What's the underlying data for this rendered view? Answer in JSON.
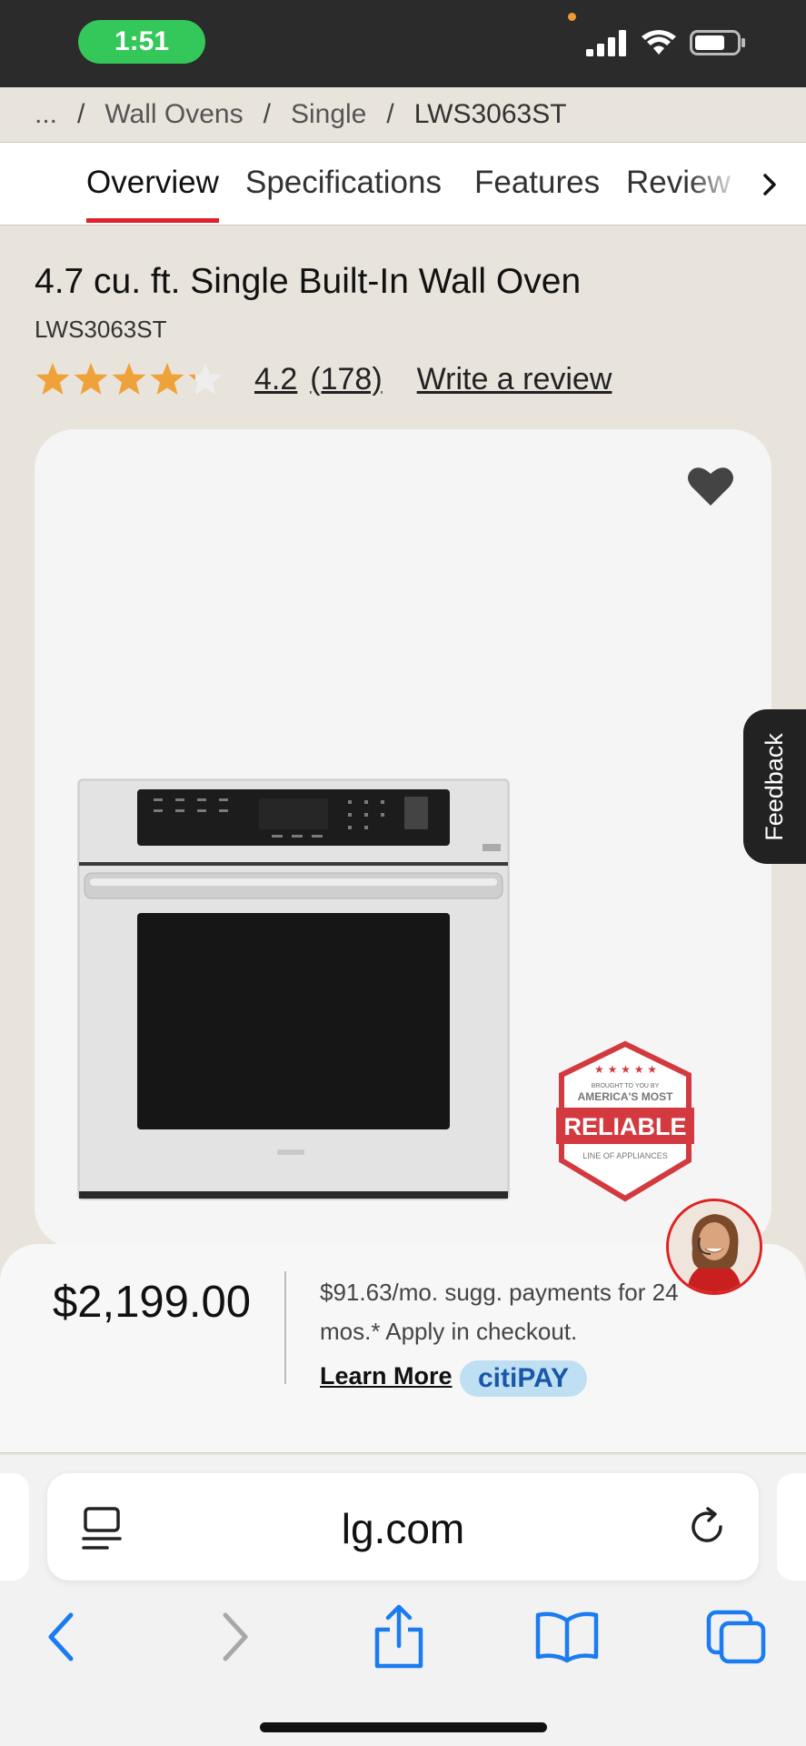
{
  "status_bar": {
    "time": "1:51"
  },
  "breadcrumb": {
    "ellipsis": "...",
    "separator": "/",
    "items": [
      "Wall Ovens",
      "Single"
    ],
    "current": "LWS3063ST"
  },
  "tabs": [
    {
      "label": "Overview",
      "active": true
    },
    {
      "label": "Specifications",
      "active": false
    },
    {
      "label": "Features",
      "active": false
    },
    {
      "label": "Review",
      "active": false
    }
  ],
  "product": {
    "title": "4.7 cu. ft. Single Built-In Wall Oven",
    "model": "LWS3063ST",
    "rating_value": "4.2",
    "rating_stars": 4.2,
    "review_count": "(178)",
    "write_review": "Write a review"
  },
  "feedback_label": "Feedback",
  "badge": {
    "line1": "BROUGHT TO YOU BY",
    "line2": "AMERICA'S MOST",
    "line3": "RELIABLE",
    "line4": "LINE OF APPLIANCES"
  },
  "price_sheet": {
    "price": "$2,199.00",
    "payment_text": "$91.63/mo. sugg. payments for 24 mos.* Apply in checkout.",
    "learn_more": "Learn More",
    "citipay": "citiPAY"
  },
  "safari": {
    "url": "lg.com"
  },
  "colors": {
    "accent_red": "#e0222d",
    "star": "#f0a23a",
    "ios_blue": "#1a7cf0",
    "status_green": "#34c759"
  }
}
